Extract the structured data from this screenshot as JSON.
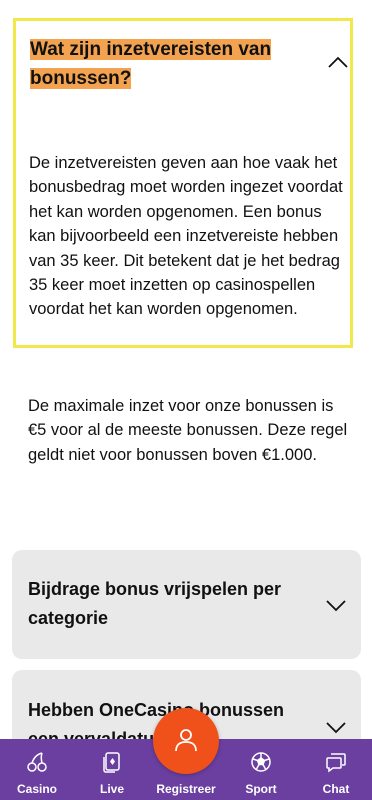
{
  "faq": {
    "open_item": {
      "question": "Wat zijn inzetvereisten van bonussen?",
      "answer": "De inzetvereisten geven aan hoe vaak het bonusbedrag moet worden ingezet voordat het kan worden opgenomen. Een bonus kan bijvoorbeeld een inzetvereiste hebben van 35 keer. Dit betekent dat je het bedrag 35 keer moet inzetten op casinospellen voordat het kan worden opgenomen."
    },
    "info_text": "De maximale inzet voor onze bonussen is €5 voor al de meeste bonussen. Deze regel geldt niet voor bonussen boven €1.000.",
    "closed_items": [
      {
        "question": "Bijdrage bonus vrijspelen per categorie"
      },
      {
        "question": "Hebben OneCasino bonussen een vervaldatum?"
      }
    ]
  },
  "bottom_nav": {
    "items": [
      {
        "label": "Casino",
        "icon": "cherries-icon"
      },
      {
        "label": "Live",
        "icon": "cards-icon"
      },
      {
        "label": "Registreer",
        "icon": "user-icon"
      },
      {
        "label": "Sport",
        "icon": "soccer-ball-icon"
      },
      {
        "label": "Chat",
        "icon": "chat-icon"
      }
    ]
  },
  "colors": {
    "highlight": "#f3a34f",
    "outline": "#f1e94a",
    "nav_bg": "#6a3fa0",
    "fab": "#f0501a",
    "accordion_bg": "#e9e9e9"
  }
}
